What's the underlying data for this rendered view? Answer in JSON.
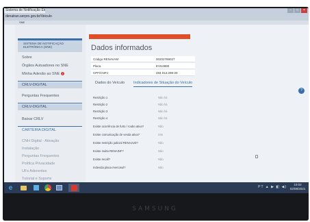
{
  "browser": {
    "tab_title": "Sistema de Notificação Eletrônica",
    "url": "denatran.serpro.gov.br/Veiculo",
    "window_controls": [
      "–",
      "□",
      "×"
    ]
  },
  "header": {
    "system_short": "SNE"
  },
  "sidebar": {
    "logo_text": "SISTEMA DE NOTIFICAÇÃO ELETRÔNICA (SNE)",
    "items": [
      {
        "label": "Sobre"
      },
      {
        "label": "Órgãos Autuadores no SNE"
      },
      {
        "label": "Minha Adesão ao SNE",
        "badge": "!"
      },
      {
        "label": "CRLV-DIGITAL"
      },
      {
        "label": "Perguntas Frequentes"
      },
      {
        "label": "CRLV-DIGITAL"
      },
      {
        "label": "Baixar CRLV"
      },
      {
        "label": "CARTEIRA DIGITAL"
      },
      {
        "label": "CNH Digital - Ativação"
      },
      {
        "label": "Instalação"
      },
      {
        "label": "Perguntas Frequentes"
      },
      {
        "label": "Política Privacidade"
      },
      {
        "label": "UFs Aderentes"
      },
      {
        "label": "Tutorial e Suporte"
      }
    ]
  },
  "main": {
    "title": "Dados informados",
    "info": [
      {
        "key": "Código RENAVAM",
        "value": "00202789027"
      },
      {
        "key": "Placa",
        "value": "EVH4980"
      },
      {
        "key": "CPF/CNPJ",
        "value": "284.012.298-20"
      }
    ],
    "tabs": [
      {
        "label": "Dados do Veículo",
        "active": false
      },
      {
        "label": "Indicadores de Situação do Veículo",
        "active": true
      }
    ],
    "indicators": [
      {
        "key": "Restrição 1",
        "value": "Não há"
      },
      {
        "key": "Restrição 2",
        "value": "Não há"
      },
      {
        "key": "Restrição 3",
        "value": "Não há"
      },
      {
        "key": "Restrição 4",
        "value": "Não há"
      },
      {
        "key": "Existe ocorrência de furto / roubo ativa?",
        "value": "Não"
      },
      {
        "key": "Existe comunicação de venda ativa?",
        "value": "Sim"
      },
      {
        "key": "Existe restrição judicial RENAJUD?",
        "value": "Não"
      },
      {
        "key": "Existe multa RENAINF?",
        "value": "Não"
      },
      {
        "key": "Existe recall?",
        "value": "Não"
      },
      {
        "key": "Indevida placa mercosul?",
        "value": "Não"
      }
    ]
  },
  "taskbar": {
    "tray_text": "PT ▲ ▶ ◧ ◀)",
    "time": "10:02",
    "date": "02/08/2021"
  },
  "brand": "SAMSUNG",
  "colors": {
    "accent_orange": "#e04e27",
    "accent_blue": "#3a6fa8",
    "taskbar": "#2b3a55"
  },
  "icons": [
    "ie-icon",
    "folder-icon",
    "media-player-icon",
    "chrome-icon",
    "image-viewer-icon",
    "pdf-reader-icon",
    "help-icon"
  ]
}
